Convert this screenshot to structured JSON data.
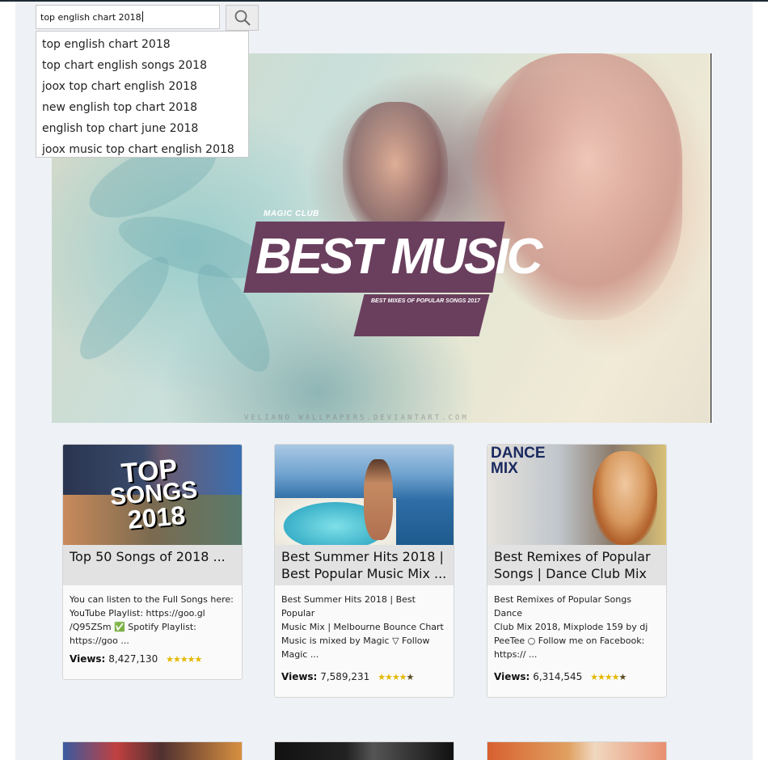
{
  "search": {
    "value": "top english chart 2018",
    "suggestions": [
      "top english chart 2018",
      "top chart english songs 2018",
      "joox top chart english 2018",
      "new english top chart 2018",
      "english top chart june 2018",
      "joox music top chart english 2018"
    ]
  },
  "banner": {
    "brand": "MAGIC CLUB",
    "title": "BEST MUSIC",
    "subtitle": "BEST MIXES OF POPULAR SONGS 2017",
    "watermark": "VELIANO WALLPAPERS.DEVIANTART.COM"
  },
  "cards": [
    {
      "title": "Top 50 Songs of 2018 ...",
      "thumb_text": [
        "TOP",
        "SONGS",
        "2018"
      ],
      "description": "You can listen to the Full Songs here:\nYouTube Playlist: https://goo.gl\n/Q95ZSm ✅ Spotify Playlist:\nhttps://goo ...",
      "views_label": "Views:",
      "views": "8,427,130",
      "rating": 5
    },
    {
      "title": "Best Summer Hits 2018 | Best Popular Music Mix ...",
      "description": "Best Summer Hits 2018 | Best Popular\nMusic Mix | Melbourne Bounce Chart\nMusic is mixed by Magic ▽ Follow\nMagic ...",
      "views_label": "Views:",
      "views": "7,589,231",
      "rating": 4.5
    },
    {
      "title": "Best Remixes of Popular Songs | Dance Club Mix ...",
      "thumb_text": [
        "DANCE",
        "MIX"
      ],
      "description": "Best Remixes of Popular Songs Dance\nClub Mix 2018, Mixplode 159 by dj\nPeeTee ○ Follow me on Facebook:\nhttps:// ...",
      "views_label": "Views:",
      "views": "6,314,545",
      "rating": 4.5
    }
  ],
  "colors": {
    "page_bg": "#eef2f6",
    "title_plate": "#6a3f5e",
    "star": "#e6b800"
  }
}
